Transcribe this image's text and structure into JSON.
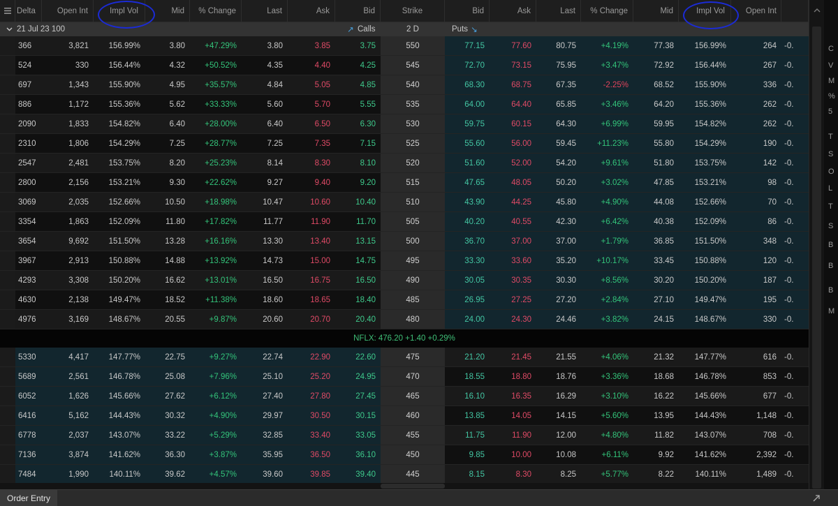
{
  "header": {
    "columns_left": [
      "Delta",
      "Open Int",
      "Impl Vol",
      "Mid",
      "% Change",
      "Last",
      "Ask",
      "Bid"
    ],
    "strike": "Strike",
    "columns_right": [
      "Bid",
      "Ask",
      "Last",
      "% Change",
      "Mid",
      "Impl Vol",
      "Open Int"
    ],
    "right_partial": ""
  },
  "group": {
    "expiry": "21 Jul 23 100",
    "calls_label": "Calls",
    "days": "2 D",
    "puts_label": "Puts"
  },
  "underlying": "NFLX: 476.20 +1.40 +0.29%",
  "rows_above": [
    {
      "delta": "366",
      "oi": "3,821",
      "iv": "156.99%",
      "mid": "3.80",
      "chg": "+47.29%",
      "last": "3.80",
      "ask": "3.85",
      "bid": "3.75",
      "strike": "550",
      "pbid": "77.15",
      "pask": "77.60",
      "plast": "80.75",
      "pchg": "+4.19%",
      "pmid": "77.38",
      "piv": "156.99%",
      "poi": "264",
      "pdelta": "-0."
    },
    {
      "delta": "524",
      "oi": "330",
      "iv": "156.44%",
      "mid": "4.32",
      "chg": "+50.52%",
      "last": "4.35",
      "ask": "4.40",
      "bid": "4.25",
      "strike": "545",
      "pbid": "72.70",
      "pask": "73.15",
      "plast": "75.95",
      "pchg": "+3.47%",
      "pmid": "72.92",
      "piv": "156.44%",
      "poi": "267",
      "pdelta": "-0."
    },
    {
      "delta": "697",
      "oi": "1,343",
      "iv": "155.90%",
      "mid": "4.95",
      "chg": "+35.57%",
      "last": "4.84",
      "ask": "5.05",
      "bid": "4.85",
      "strike": "540",
      "pbid": "68.30",
      "pask": "68.75",
      "plast": "67.35",
      "pchg": "-2.25%",
      "pmid": "68.52",
      "piv": "155.90%",
      "poi": "336",
      "pdelta": "-0."
    },
    {
      "delta": "886",
      "oi": "1,172",
      "iv": "155.36%",
      "mid": "5.62",
      "chg": "+33.33%",
      "last": "5.60",
      "ask": "5.70",
      "bid": "5.55",
      "strike": "535",
      "pbid": "64.00",
      "pask": "64.40",
      "plast": "65.85",
      "pchg": "+3.46%",
      "pmid": "64.20",
      "piv": "155.36%",
      "poi": "262",
      "pdelta": "-0."
    },
    {
      "delta": "2090",
      "oi": "1,833",
      "iv": "154.82%",
      "mid": "6.40",
      "chg": "+28.00%",
      "last": "6.40",
      "ask": "6.50",
      "bid": "6.30",
      "strike": "530",
      "pbid": "59.75",
      "pask": "60.15",
      "plast": "64.30",
      "pchg": "+6.99%",
      "pmid": "59.95",
      "piv": "154.82%",
      "poi": "262",
      "pdelta": "-0."
    },
    {
      "delta": "2310",
      "oi": "1,806",
      "iv": "154.29%",
      "mid": "7.25",
      "chg": "+28.77%",
      "last": "7.25",
      "ask": "7.35",
      "bid": "7.15",
      "strike": "525",
      "pbid": "55.60",
      "pask": "56.00",
      "plast": "59.45",
      "pchg": "+11.23%",
      "pmid": "55.80",
      "piv": "154.29%",
      "poi": "190",
      "pdelta": "-0."
    },
    {
      "delta": "2547",
      "oi": "2,481",
      "iv": "153.75%",
      "mid": "8.20",
      "chg": "+25.23%",
      "last": "8.14",
      "ask": "8.30",
      "bid": "8.10",
      "strike": "520",
      "pbid": "51.60",
      "pask": "52.00",
      "plast": "54.20",
      "pchg": "+9.61%",
      "pmid": "51.80",
      "piv": "153.75%",
      "poi": "142",
      "pdelta": "-0."
    },
    {
      "delta": "2800",
      "oi": "2,156",
      "iv": "153.21%",
      "mid": "9.30",
      "chg": "+22.62%",
      "last": "9.27",
      "ask": "9.40",
      "bid": "9.20",
      "strike": "515",
      "pbid": "47.65",
      "pask": "48.05",
      "plast": "50.20",
      "pchg": "+3.02%",
      "pmid": "47.85",
      "piv": "153.21%",
      "poi": "98",
      "pdelta": "-0."
    },
    {
      "delta": "3069",
      "oi": "2,035",
      "iv": "152.66%",
      "mid": "10.50",
      "chg": "+18.98%",
      "last": "10.47",
      "ask": "10.60",
      "bid": "10.40",
      "strike": "510",
      "pbid": "43.90",
      "pask": "44.25",
      "plast": "45.80",
      "pchg": "+4.90%",
      "pmid": "44.08",
      "piv": "152.66%",
      "poi": "70",
      "pdelta": "-0."
    },
    {
      "delta": "3354",
      "oi": "1,863",
      "iv": "152.09%",
      "mid": "11.80",
      "chg": "+17.82%",
      "last": "11.77",
      "ask": "11.90",
      "bid": "11.70",
      "strike": "505",
      "pbid": "40.20",
      "pask": "40.55",
      "plast": "42.30",
      "pchg": "+6.42%",
      "pmid": "40.38",
      "piv": "152.09%",
      "poi": "86",
      "pdelta": "-0."
    },
    {
      "delta": "3654",
      "oi": "9,692",
      "iv": "151.50%",
      "mid": "13.28",
      "chg": "+16.16%",
      "last": "13.30",
      "ask": "13.40",
      "bid": "13.15",
      "strike": "500",
      "pbid": "36.70",
      "pask": "37.00",
      "plast": "37.00",
      "pchg": "+1.79%",
      "pmid": "36.85",
      "piv": "151.50%",
      "poi": "348",
      "pdelta": "-0."
    },
    {
      "delta": "3967",
      "oi": "2,913",
      "iv": "150.88%",
      "mid": "14.88",
      "chg": "+13.92%",
      "last": "14.73",
      "ask": "15.00",
      "bid": "14.75",
      "strike": "495",
      "pbid": "33.30",
      "pask": "33.60",
      "plast": "35.20",
      "pchg": "+10.17%",
      "pmid": "33.45",
      "piv": "150.88%",
      "poi": "120",
      "pdelta": "-0."
    },
    {
      "delta": "4293",
      "oi": "3,308",
      "iv": "150.20%",
      "mid": "16.62",
      "chg": "+13.01%",
      "last": "16.50",
      "ask": "16.75",
      "bid": "16.50",
      "strike": "490",
      "pbid": "30.05",
      "pask": "30.35",
      "plast": "30.30",
      "pchg": "+8.56%",
      "pmid": "30.20",
      "piv": "150.20%",
      "poi": "187",
      "pdelta": "-0."
    },
    {
      "delta": "4630",
      "oi": "2,138",
      "iv": "149.47%",
      "mid": "18.52",
      "chg": "+11.38%",
      "last": "18.60",
      "ask": "18.65",
      "bid": "18.40",
      "strike": "485",
      "pbid": "26.95",
      "pask": "27.25",
      "plast": "27.20",
      "pchg": "+2.84%",
      "pmid": "27.10",
      "piv": "149.47%",
      "poi": "195",
      "pdelta": "-0."
    },
    {
      "delta": "4976",
      "oi": "3,169",
      "iv": "148.67%",
      "mid": "20.55",
      "chg": "+9.87%",
      "last": "20.60",
      "ask": "20.70",
      "bid": "20.40",
      "strike": "480",
      "pbid": "24.00",
      "pask": "24.30",
      "plast": "24.46",
      "pchg": "+3.82%",
      "pmid": "24.15",
      "piv": "148.67%",
      "poi": "330",
      "pdelta": "-0."
    }
  ],
  "rows_below": [
    {
      "delta": "5330",
      "oi": "4,417",
      "iv": "147.77%",
      "mid": "22.75",
      "chg": "+9.27%",
      "last": "22.74",
      "ask": "22.90",
      "bid": "22.60",
      "strike": "475",
      "pbid": "21.20",
      "pask": "21.45",
      "plast": "21.55",
      "pchg": "+4.06%",
      "pmid": "21.32",
      "piv": "147.77%",
      "poi": "616",
      "pdelta": "-0."
    },
    {
      "delta": "5689",
      "oi": "2,561",
      "iv": "146.78%",
      "mid": "25.08",
      "chg": "+7.96%",
      "last": "25.10",
      "ask": "25.20",
      "bid": "24.95",
      "strike": "470",
      "pbid": "18.55",
      "pask": "18.80",
      "plast": "18.76",
      "pchg": "+3.36%",
      "pmid": "18.68",
      "piv": "146.78%",
      "poi": "853",
      "pdelta": "-0."
    },
    {
      "delta": "6052",
      "oi": "1,626",
      "iv": "145.66%",
      "mid": "27.62",
      "chg": "+6.12%",
      "last": "27.40",
      "ask": "27.80",
      "bid": "27.45",
      "strike": "465",
      "pbid": "16.10",
      "pask": "16.35",
      "plast": "16.29",
      "pchg": "+3.10%",
      "pmid": "16.22",
      "piv": "145.66%",
      "poi": "677",
      "pdelta": "-0."
    },
    {
      "delta": "6416",
      "oi": "5,162",
      "iv": "144.43%",
      "mid": "30.32",
      "chg": "+4.90%",
      "last": "29.97",
      "ask": "30.50",
      "bid": "30.15",
      "strike": "460",
      "pbid": "13.85",
      "pask": "14.05",
      "plast": "14.15",
      "pchg": "+5.60%",
      "pmid": "13.95",
      "piv": "144.43%",
      "poi": "1,148",
      "pdelta": "-0."
    },
    {
      "delta": "6778",
      "oi": "2,037",
      "iv": "143.07%",
      "mid": "33.22",
      "chg": "+5.29%",
      "last": "32.85",
      "ask": "33.40",
      "bid": "33.05",
      "strike": "455",
      "pbid": "11.75",
      "pask": "11.90",
      "plast": "12.00",
      "pchg": "+4.80%",
      "pmid": "11.82",
      "piv": "143.07%",
      "poi": "708",
      "pdelta": "-0."
    },
    {
      "delta": "7136",
      "oi": "3,874",
      "iv": "141.62%",
      "mid": "36.30",
      "chg": "+3.87%",
      "last": "35.95",
      "ask": "36.50",
      "bid": "36.10",
      "strike": "450",
      "pbid": "9.85",
      "pask": "10.00",
      "plast": "10.08",
      "pchg": "+6.11%",
      "pmid": "9.92",
      "piv": "141.62%",
      "poi": "2,392",
      "pdelta": "-0."
    },
    {
      "delta": "7484",
      "oi": "1,990",
      "iv": "140.11%",
      "mid": "39.62",
      "chg": "+4.57%",
      "last": "39.60",
      "ask": "39.85",
      "bid": "39.40",
      "strike": "445",
      "pbid": "8.15",
      "pask": "8.30",
      "plast": "8.25",
      "pchg": "+5.77%",
      "pmid": "8.22",
      "piv": "140.11%",
      "poi": "1,489",
      "pdelta": "-0."
    }
  ],
  "bottom": {
    "order_entry": "Order Entry"
  },
  "right_panel_letters": [
    "C",
    "V",
    "M",
    "%",
    "5",
    "T",
    "S",
    "O",
    "L",
    "T",
    "S",
    "B",
    "B",
    "B",
    "M"
  ],
  "colors": {
    "ask": "#e04a66",
    "bid": "#3ec98b",
    "positive": "#33c47a",
    "negative": "#e0435c",
    "itm_bg": "#12262e",
    "annotation": "#1b2bd6"
  }
}
